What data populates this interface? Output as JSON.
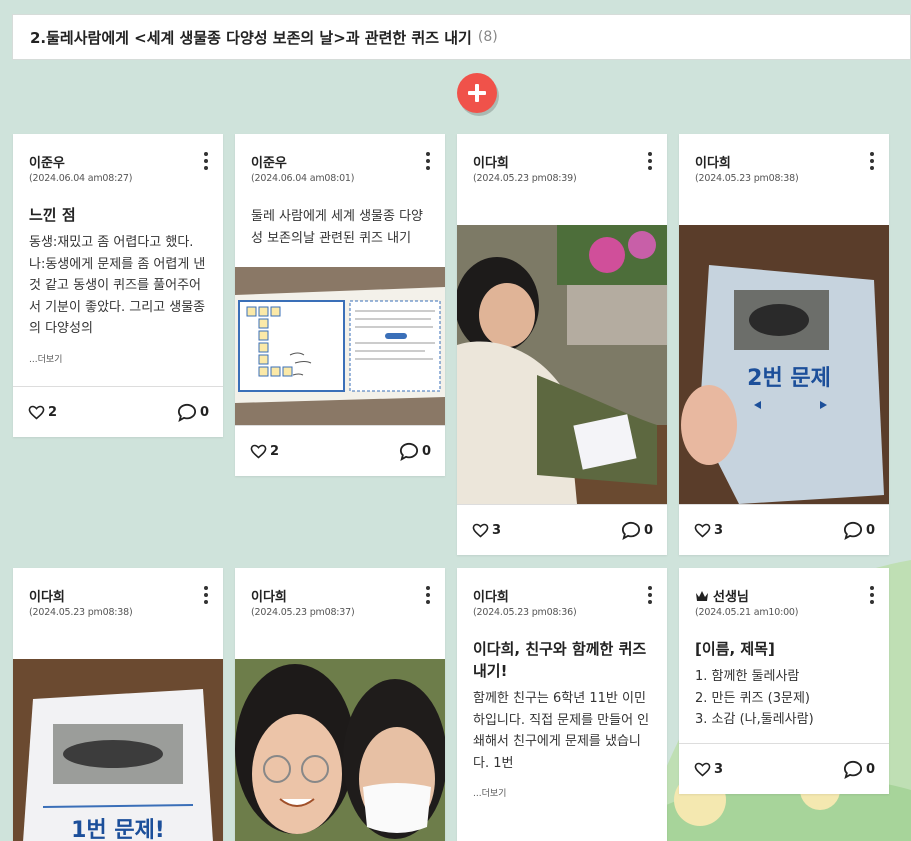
{
  "section": {
    "title": "2.둘레사람에게 <세계 생물종 다양성 보존의 날>과 관련한 퀴즈 내기",
    "count": "(8)"
  },
  "add_button": {
    "icon": "plus-icon",
    "color": "#f0524a"
  },
  "posts": [
    {
      "author": "이준우",
      "date": "(2024.06.04 am08:27)",
      "title": "느낀 점",
      "body": "동생:재밌고 좀 어렵다고 했다. 나:동생에게 문제를 좀 어렵게 낸 것 같고 동생이 퀴즈를 풀어주어서 기분이 좋았다. 그리고 생물종의 다양성의",
      "more": "...더보기",
      "likes": "2",
      "comments": "0"
    },
    {
      "author": "이준우",
      "date": "(2024.06.04 am08:01)",
      "body": "둘레 사람에게 세계 생물종 다양성 보존의날 관련된 퀴즈 내기",
      "likes": "2",
      "comments": "0"
    },
    {
      "author": "이다희",
      "date": "(2024.05.23 pm08:39)",
      "likes": "3",
      "comments": "0"
    },
    {
      "author": "이다희",
      "date": "(2024.05.23 pm08:38)",
      "likes": "3",
      "comments": "0",
      "photo_text": "2번 문제"
    },
    {
      "author": "이다희",
      "date": "(2024.05.23 pm08:38)",
      "photo_text": "1번 문제!"
    },
    {
      "author": "이다희",
      "date": "(2024.05.23 pm08:37)"
    },
    {
      "author": "이다희",
      "date": "(2024.05.23 pm08:36)",
      "title": "이다희,  친구와 함께한 퀴즈 내기!",
      "body": "함께한 친구는 6학년 11반 이민하입니다. 직접 문제를 만들어 인쇄해서 친구에게 문제를 냈습니다. 1번",
      "more": "...더보기"
    },
    {
      "author": "선생님",
      "date": "(2024.05.21 am10:00)",
      "title": "[이름, 제목]",
      "lines": [
        "1. 함께한 둘레사람",
        "2. 만든 퀴즈 (3문제)",
        "3. 소감 (나,둘레사람)"
      ],
      "likes": "3",
      "comments": "0"
    }
  ]
}
